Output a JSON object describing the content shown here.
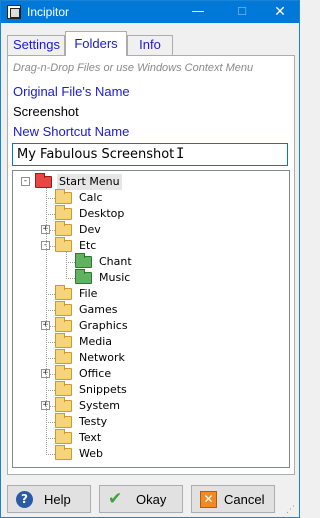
{
  "window": {
    "title": "Incipitor",
    "minimize_glyph": "—",
    "maximize_glyph": "☐",
    "close_glyph": "✕"
  },
  "tabs": [
    {
      "label": "Settings",
      "active": false
    },
    {
      "label": "Folders",
      "active": true
    },
    {
      "label": "Info",
      "active": false
    }
  ],
  "content": {
    "hint": "Drag-n-Drop Files or use Windows Context Menu",
    "original_label": "Original File's Name",
    "original_value": "Screenshot",
    "shortcut_label": "New Shortcut Name",
    "shortcut_value": "My Fabulous Screenshot"
  },
  "tree": {
    "root": {
      "label": "Start Menu",
      "icon": "red-folder-icon",
      "expanded": true
    },
    "items": [
      {
        "label": "Calc",
        "expander": ""
      },
      {
        "label": "Desktop",
        "expander": ""
      },
      {
        "label": "Dev",
        "expander": "+"
      },
      {
        "label": "Etc",
        "expander": "-",
        "children": [
          {
            "label": "Chant",
            "icon": "green-folder-icon"
          },
          {
            "label": "Music",
            "icon": "green-folder-icon"
          }
        ]
      },
      {
        "label": "File",
        "expander": ""
      },
      {
        "label": "Games",
        "expander": ""
      },
      {
        "label": "Graphics",
        "expander": "+"
      },
      {
        "label": "Media",
        "expander": ""
      },
      {
        "label": "Network",
        "expander": ""
      },
      {
        "label": "Office",
        "expander": "+"
      },
      {
        "label": "Snippets",
        "expander": ""
      },
      {
        "label": "System",
        "expander": "+"
      },
      {
        "label": "Testy",
        "expander": ""
      },
      {
        "label": "Text",
        "expander": ""
      },
      {
        "label": "Web",
        "expander": ""
      }
    ]
  },
  "buttons": {
    "help": "Help",
    "okay": "Okay",
    "cancel": "Cancel"
  },
  "colors": {
    "titlebar": "#0078d7",
    "label_blue": "#1a1ad6",
    "folder_yellow": "#f6d57a",
    "folder_red": "#e84545",
    "folder_green": "#5fb35f"
  }
}
